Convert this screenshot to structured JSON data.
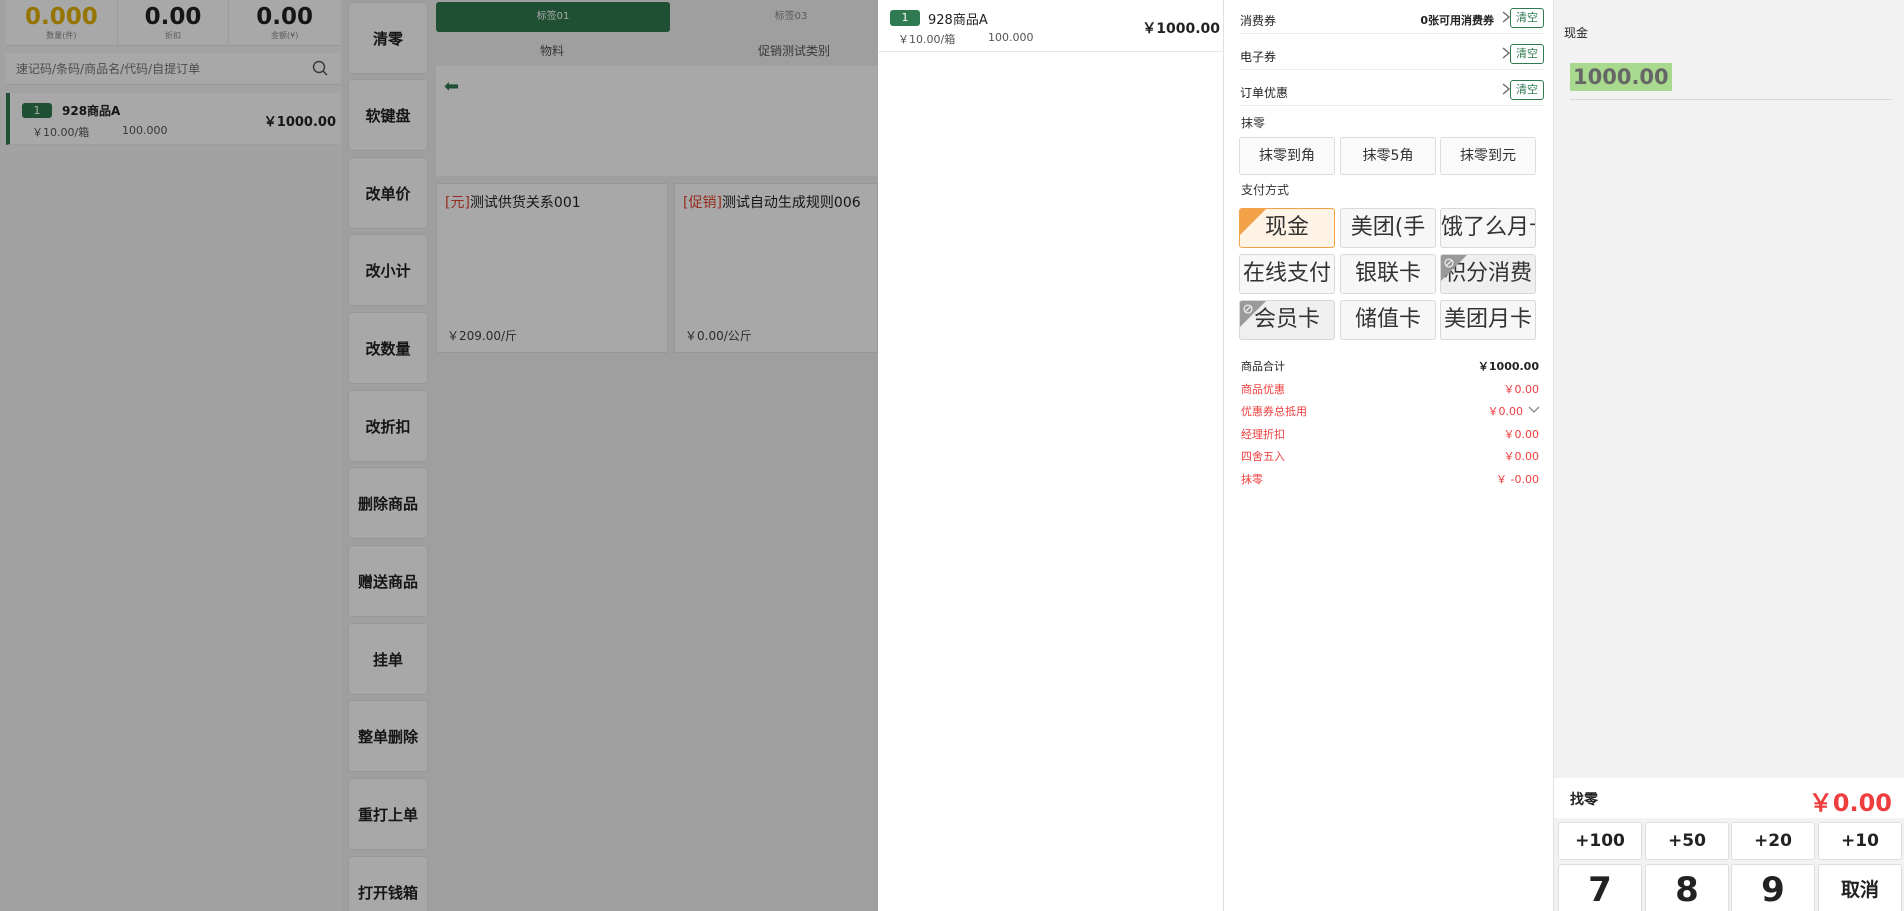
{
  "stats": [
    {
      "value": "0.000",
      "label": "数量(件)"
    },
    {
      "value": "0.00",
      "label": "折扣"
    },
    {
      "value": "0.00",
      "label": "金额(¥)"
    }
  ],
  "search": {
    "placeholder": "速记码/条码/商品名/代码/自提订单"
  },
  "cart": {
    "index": "1",
    "name": "928商品A",
    "unit_price": "￥10.00/箱",
    "qty": "100.000",
    "amount": "￥1000.00"
  },
  "functions": [
    "清零",
    "软键盘",
    "改单价",
    "改小计",
    "改数量",
    "改折扣",
    "删除商品",
    "赠送商品",
    "挂单",
    "整单删除",
    "重打上单",
    "打开钱箱"
  ],
  "tabs": [
    "标签01",
    "标签03"
  ],
  "categories": [
    "物料",
    "促销测试类别"
  ],
  "products": [
    {
      "tag": "[元]",
      "name": "测试供货关系001",
      "price": "￥209.00/斤"
    },
    {
      "tag": "[促销]",
      "name": "测试自动生成规则006",
      "price": "￥0.00/公斤"
    }
  ],
  "order": {
    "index": "1",
    "name": "928商品A",
    "unit_price": "￥10.00/箱",
    "qty": "100.000",
    "amount": "￥1000.00"
  },
  "coupons": [
    {
      "label": "消费券",
      "info": "0张可用消费券",
      "clear": "清空"
    },
    {
      "label": "电子券",
      "info": "",
      "clear": "清空"
    },
    {
      "label": "订单优惠",
      "info": "",
      "clear": "清空"
    }
  ],
  "rounding": {
    "title": "抹零",
    "buttons": [
      "抹零到角",
      "抹零5角",
      "抹零到元"
    ]
  },
  "payment": {
    "title": "支付方式",
    "methods": [
      "现金",
      "美团(手",
      "饿了么月卡",
      "在线支付",
      "银联卡",
      "积分消费",
      "会员卡",
      "储值卡",
      "美团月卡"
    ]
  },
  "summary": [
    {
      "label": "商品合计",
      "value": "￥1000.00"
    },
    {
      "label": "商品优惠",
      "value": "￥0.00"
    },
    {
      "label": "优惠券总抵用",
      "value": "￥0.00"
    },
    {
      "label": "经理折扣",
      "value": "￥0.00"
    },
    {
      "label": "四舍五入",
      "value": "￥0.00"
    },
    {
      "label": "抹零",
      "value": "￥ -0.00"
    }
  ],
  "cash": {
    "label": "现金",
    "input_value": "1000.00",
    "change_label": "找零",
    "change_value": "￥0.00",
    "quick": [
      "+100",
      "+50",
      "+20",
      "+10"
    ],
    "keys": [
      "7",
      "8",
      "9",
      "取消"
    ]
  },
  "colors": {
    "brand_green": "#2f7a50",
    "alert_red": "#ef3d3d",
    "selected_orange": "#f3a24a",
    "input_highlight": "#a9d98e"
  }
}
